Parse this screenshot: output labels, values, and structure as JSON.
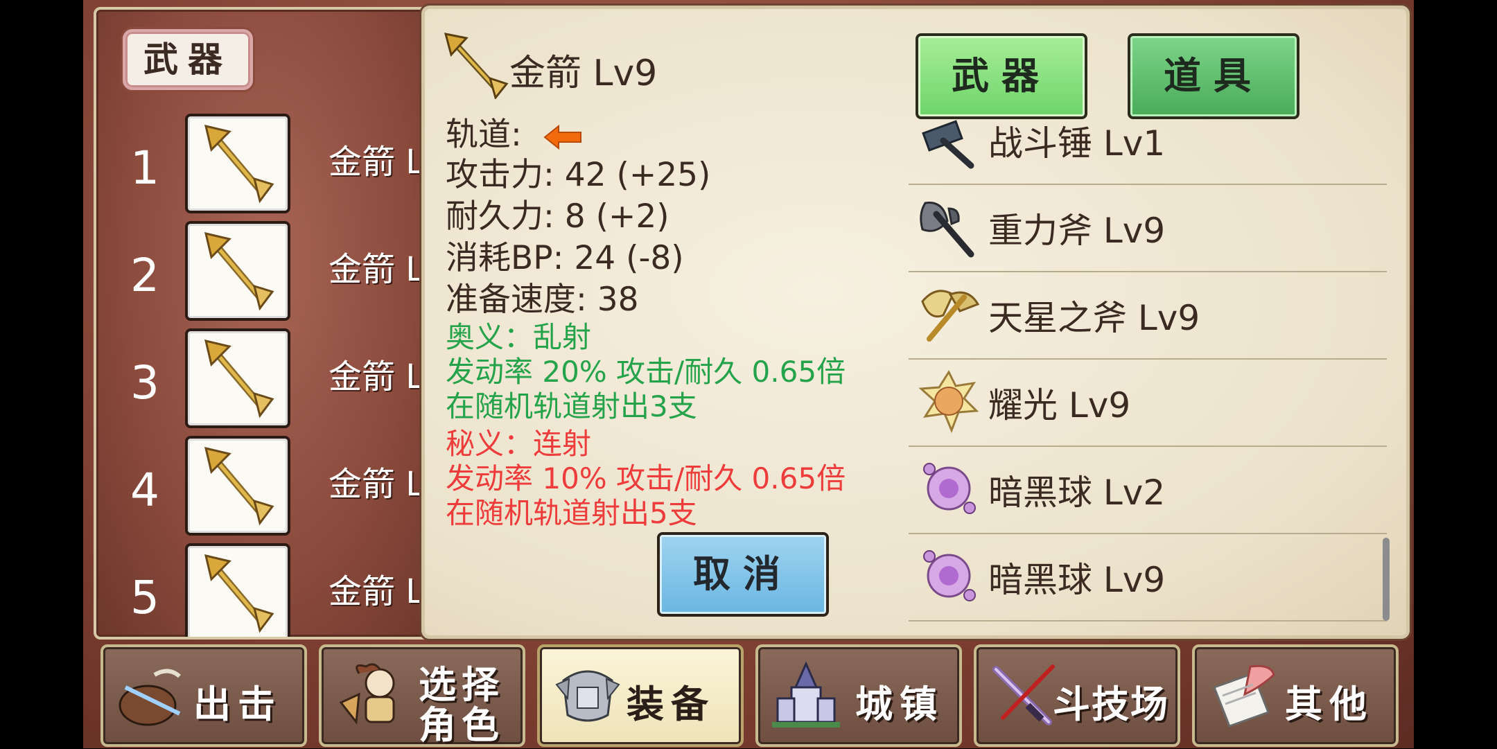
{
  "left_panel": {
    "title": "武器",
    "slots": [
      {
        "num": "1",
        "label": "金箭 L",
        "icon": "golden-arrow-icon"
      },
      {
        "num": "2",
        "label": "金箭 L",
        "icon": "golden-arrow-icon"
      },
      {
        "num": "3",
        "label": "金箭 L",
        "icon": "golden-arrow-icon"
      },
      {
        "num": "4",
        "label": "金箭 L",
        "icon": "golden-arrow-icon"
      },
      {
        "num": "5",
        "label": "金箭 L",
        "icon": "golden-arrow-icon"
      }
    ]
  },
  "detail": {
    "name": "金箭 Lv9",
    "icon": "golden-arrow-icon",
    "track_label": "轨道:",
    "track_icon": "orange-left-arrow-icon",
    "attack": "攻击力: 42 (+25)",
    "durability": "耐久力: 8 (+2)",
    "bp_cost": "消耗BP: 24 (-8)",
    "ready_speed": "准备速度: 38",
    "secret1_title": "奥义：乱射",
    "secret1_rate": "发动率 20%  攻击/耐久 0.65倍",
    "secret1_desc": "在随机轨道射出3支",
    "secret2_title": "秘义：连射",
    "secret2_rate": "发动率 10%    攻击/耐久 0.65倍",
    "secret2_desc": "在随机轨道射出5支",
    "cancel_label": "取消"
  },
  "tabs": {
    "weapon": "武器",
    "item": "道具"
  },
  "inventory": [
    {
      "name": "战斗锤 Lv1",
      "icon": "war-hammer-icon"
    },
    {
      "name": "重力斧 Lv9",
      "icon": "gravity-axe-icon"
    },
    {
      "name": "天星之斧 Lv9",
      "icon": "star-axe-icon"
    },
    {
      "name": "耀光 Lv9",
      "icon": "radiance-orb-icon"
    },
    {
      "name": "暗黑球 Lv2",
      "icon": "dark-orb-icon"
    },
    {
      "name": "暗黑球 Lv9",
      "icon": "dark-orb-icon"
    }
  ],
  "nav": {
    "sortie": "出击",
    "select_line1": "选择",
    "select_line2": "角色",
    "equip": "装备",
    "town": "城镇",
    "arena": "斗技场",
    "other": "其他"
  },
  "colors": {
    "secret_green": "#25a34b",
    "secret_red": "#ee3b3b",
    "tab_green": "#6ed46a",
    "cancel_blue": "#6ab6e2"
  }
}
